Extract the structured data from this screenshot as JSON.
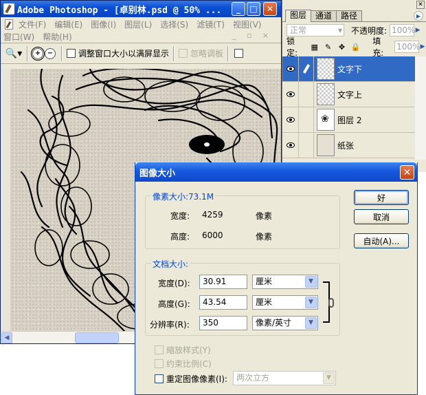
{
  "ps_window": {
    "title": "Adobe Photoshop - [卓别林.psd @ 50% ...",
    "menu_row1": [
      "文件(F)",
      "编辑(E)",
      "图像(I)",
      "图层(L)",
      "选择(S)",
      "滤镜(T)",
      "视图(V)"
    ],
    "menu_row2": [
      "窗口(W)",
      "帮助(H)"
    ],
    "options": {
      "zoom_in": "+",
      "zoom_out": "−",
      "resize_to_fit_label": "调整窗口大小以满屏显示",
      "ignore_palettes_label": "忽略调板"
    }
  },
  "layers_panel": {
    "tabs": [
      "图层",
      "通道",
      "路径"
    ],
    "blend_mode": "正常",
    "opacity_label": "不透明度:",
    "opacity_value": "100%",
    "lock_label": "锁定:",
    "fill_label": "填充:",
    "fill_value": "100%",
    "layers": [
      {
        "name": "文字下",
        "selected": true,
        "thumb": "transparent"
      },
      {
        "name": "文字上",
        "selected": false,
        "thumb": "transparent"
      },
      {
        "name": "图层 2",
        "selected": false,
        "thumb": "art"
      },
      {
        "name": "纸张",
        "selected": false,
        "thumb": "paper"
      }
    ]
  },
  "image_size_dialog": {
    "title": "图像大小",
    "pixel_dimensions": {
      "title": "像素大小:73.1M",
      "width_label": "宽度:",
      "width_value": "4259",
      "width_unit": "像素",
      "height_label": "高度:",
      "height_value": "6000",
      "height_unit": "像素"
    },
    "document_size": {
      "title": "文档大小:",
      "width_label": "宽度(D):",
      "width_value": "30.91",
      "width_unit": "厘米",
      "height_label": "高度(G):",
      "height_value": "43.54",
      "height_unit": "厘米",
      "resolution_label": "分辨率(R):",
      "resolution_value": "350",
      "resolution_unit": "像素/英寸"
    },
    "buttons": {
      "ok": "好",
      "cancel": "取消",
      "auto": "自动(A)..."
    },
    "scale_styles": "缩放样式(Y)",
    "constrain_proportions": "约束比例(C)",
    "resample": "重定图像像素(I):",
    "resample_method": "两次立方"
  }
}
